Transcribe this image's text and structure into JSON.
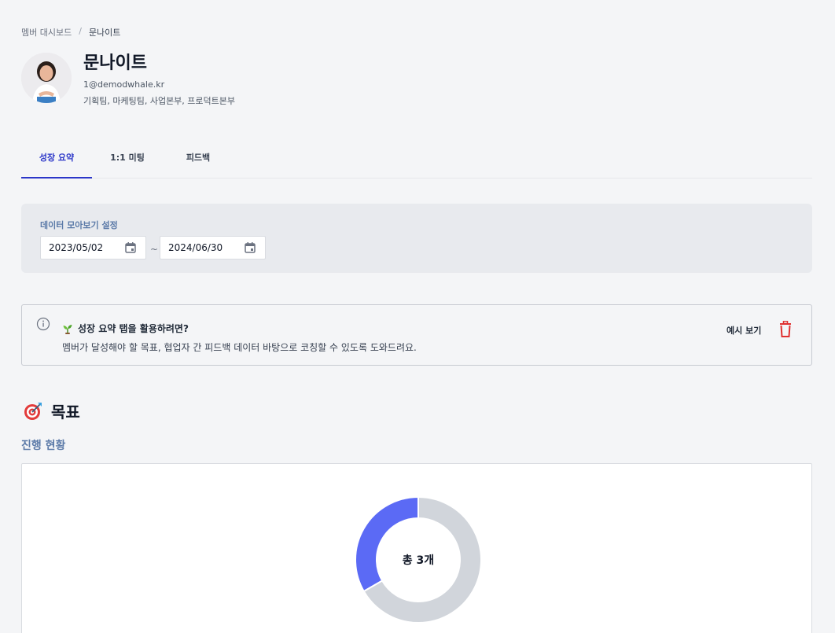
{
  "breadcrumb": {
    "parent": "멤버 대시보드",
    "separator": "/",
    "current": "문나이트"
  },
  "profile": {
    "name": "문나이트",
    "email": "1@demodwhale.kr",
    "teams": "기획팀, 마케팅팀, 사업본부, 프로덕트본부",
    "avatar_icon": "person-avatar"
  },
  "tabs": [
    {
      "label": "성장 요약",
      "active": true
    },
    {
      "label": "1:1 미팅",
      "active": false
    },
    {
      "label": "피드백",
      "active": false
    }
  ],
  "filter": {
    "label": "데이터 모아보기 설정",
    "start_date": "2023/05/02",
    "end_date": "2024/06/30",
    "range_separator": "~",
    "calendar_icon": "calendar-icon"
  },
  "info": {
    "title": "성장 요약 탭을 활용하려면?",
    "description": "멤버가 달성해야 할 목표, 협업자 간 피드백 데이터 바탕으로 코칭할 수 있도록 도와드려요.",
    "example_label": "예시 보기",
    "icons": [
      "info-circle-icon",
      "sprout-icon",
      "trash-icon"
    ]
  },
  "goals": {
    "title": "목표",
    "progress_label": "진행 현황",
    "total_text": "총 3개"
  },
  "chart_data": {
    "type": "pie",
    "style": "donut",
    "center_label": "총 3개",
    "total": 3,
    "values": [
      1,
      2
    ],
    "colors": [
      "#5b6af5",
      "#d1d5db"
    ]
  },
  "colors": {
    "accent": "#2b36c8",
    "label_blue": "#5b7aa8",
    "trash_red": "#e03131",
    "donut_fill": "#5b6af5",
    "donut_track": "#d1d5db"
  }
}
